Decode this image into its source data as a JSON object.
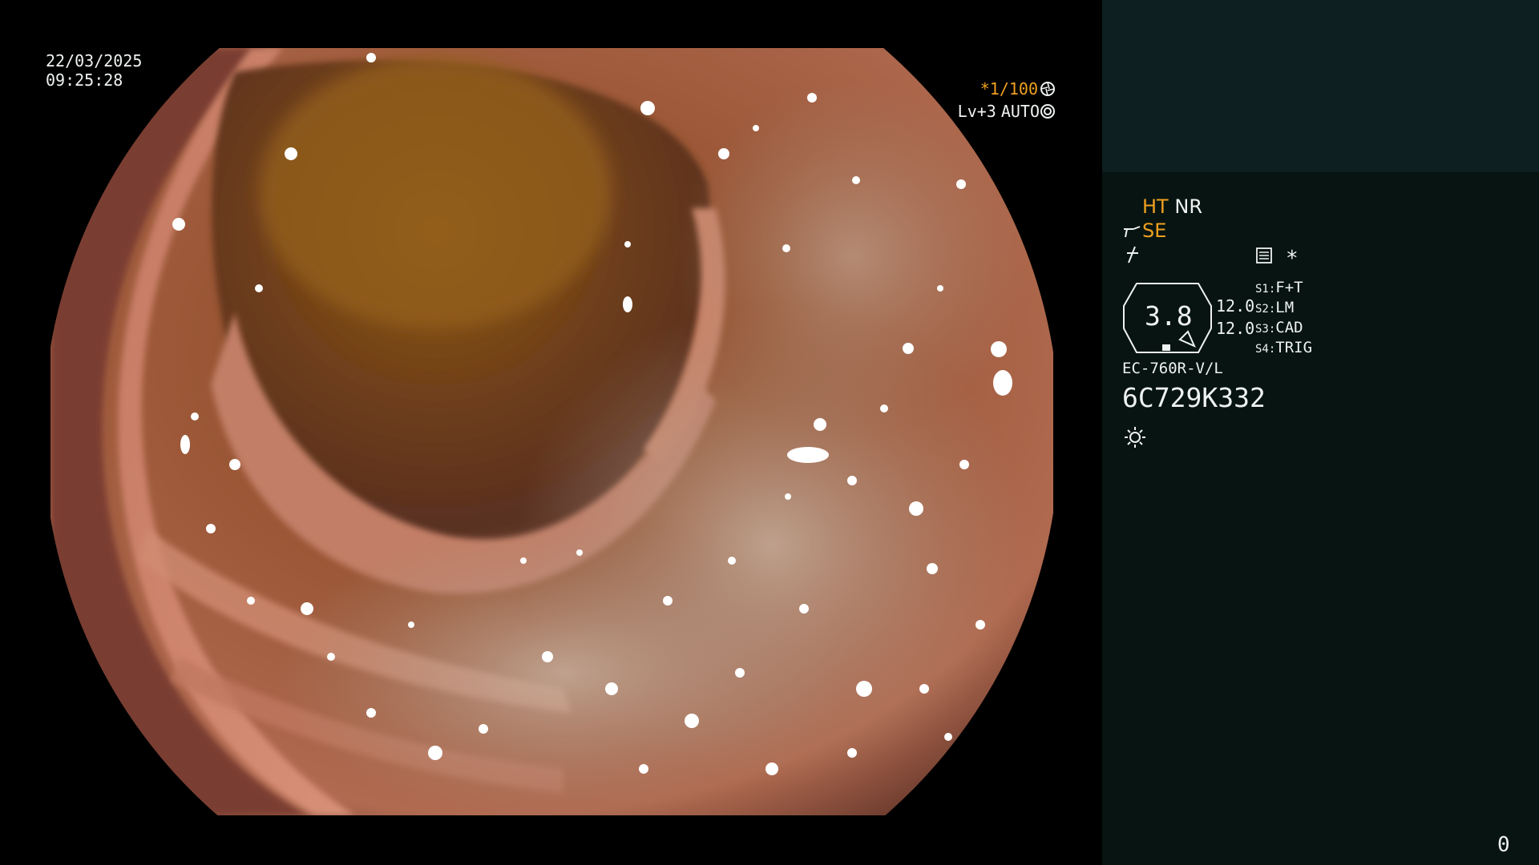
{
  "timestamp": {
    "date": "22/03/2025",
    "time": "09:25:28"
  },
  "exposure": {
    "shutter": "*1/100",
    "iris_level": "Lv+3",
    "iris_mode": "AUTO"
  },
  "enhancement": {
    "ht": "HT",
    "nr": "NR",
    "se": "SE"
  },
  "settings": {
    "hood_value": "3.8",
    "gauge_top": "12.0",
    "gauge_bottom": "12.0",
    "switches": [
      {
        "key": "S1",
        "label": "F+T"
      },
      {
        "key": "S2",
        "label": "LM"
      },
      {
        "key": "S3",
        "label": "CAD"
      },
      {
        "key": "S4",
        "label": "TRIG"
      }
    ],
    "asterisk": "*"
  },
  "scope": {
    "model": "EC-760R-V/L",
    "serial": "6C729K332"
  },
  "counter": "0",
  "colors": {
    "osd_white": "#eef2f0",
    "osd_orange": "#f0a020",
    "panel_bg": "#071412",
    "panel_top_bg": "#0d1f20"
  },
  "icons": [
    "shutter-aperture-icon",
    "iris-icon",
    "scope-tip-icon",
    "flash-icon",
    "memo-card-icon",
    "brightness-sun-icon"
  ]
}
